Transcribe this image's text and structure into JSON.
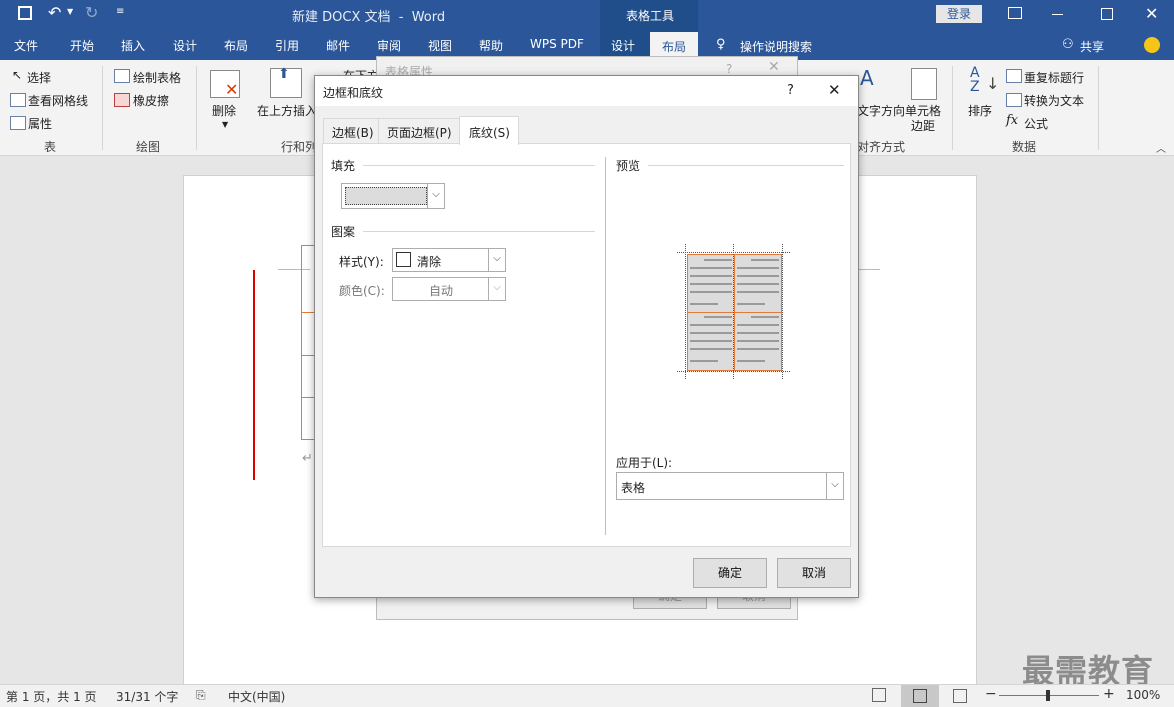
{
  "window": {
    "title": "新建 DOCX 文档  -  Word",
    "context_group": "表格工具",
    "login_label": "登录"
  },
  "tabs": [
    "文件",
    "开始",
    "插入",
    "设计",
    "布局",
    "引用",
    "邮件",
    "审阅",
    "视图",
    "帮助",
    "WPS PDF",
    "设计",
    "布局"
  ],
  "search_label": "操作说明搜索",
  "share_label": "共享",
  "ribbon": {
    "select": "选择",
    "view_gridlines": "查看网格线",
    "properties": "属性",
    "draw_table": "绘制表格",
    "eraser": "橡皮擦",
    "delete": "删除",
    "insert_above": "在上方插入",
    "insert_below_partial": "在下方",
    "text_direction": "文字方向",
    "cell_margins_1": "单元格",
    "cell_margins_2": "边距",
    "sort": "排序",
    "repeat_header": "重复标题行",
    "convert_text": "转换为文本",
    "formula": "公式",
    "group_table": "表",
    "group_draw": "绘图",
    "group_rowcol": "行和列",
    "group_align": "对齐方式",
    "group_data": "数据"
  },
  "bg_dialog": {
    "title": "表格属性",
    "help": "?",
    "ok": "确定",
    "cancel": "取消"
  },
  "dialog": {
    "title": "边框和底纹",
    "help": "?",
    "tabs": [
      "边框(B)",
      "页面边框(P)",
      "底纹(S)"
    ],
    "active_tab": 2,
    "fill_label": "填充",
    "pattern_label": "图案",
    "style_label": "样式(Y):",
    "style_value": "清除",
    "color_label": "颜色(C):",
    "color_value": "自动",
    "preview_label": "预览",
    "apply_label": "应用于(L):",
    "apply_value": "表格",
    "ok": "确定",
    "cancel": "取消"
  },
  "status": {
    "page": "第 1 页，共 1 页",
    "words": "31/31 个字",
    "language": "中文(中国)",
    "zoom": "100%"
  },
  "watermark": "最需教育",
  "colors": {
    "accent": "#2b579a",
    "table_border": "#e07b39",
    "margin_line": "#e00000"
  }
}
